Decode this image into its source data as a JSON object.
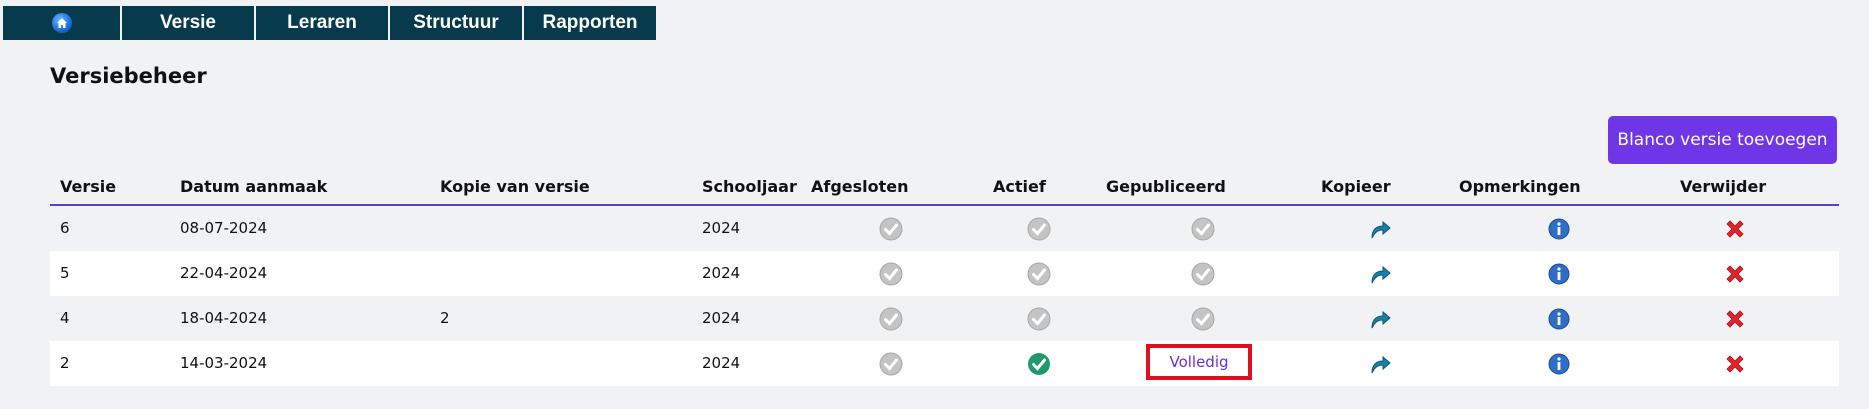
{
  "nav": {
    "home_icon": "home-icon",
    "items": [
      "Versie",
      "Leraren",
      "Structuur",
      "Rapporten"
    ]
  },
  "page": {
    "title": "Versiebeheer",
    "add_button": "Blanco versie toevoegen"
  },
  "colors": {
    "nav_bg": "#083a4e",
    "accent": "#6f36e8",
    "header_rule": "#5b3fd0",
    "highlight_border": "#e0101e"
  },
  "table": {
    "headers": {
      "versie": "Versie",
      "datum": "Datum aanmaak",
      "kopie": "Kopie van versie",
      "schooljaar": "Schooljaar",
      "afgesloten": "Afgesloten",
      "actief": "Actief",
      "gepubliceerd": "Gepubliceerd",
      "kopieer": "Kopieer",
      "opmerkingen": "Opmerkingen",
      "verwijder": "Verwijder"
    },
    "rows": [
      {
        "versie": "6",
        "datum": "08-07-2024",
        "kopie": "",
        "schooljaar": "2024",
        "afgesloten": "grey-check-icon",
        "actief": "grey-check-icon",
        "gepubliceerd": "grey-check-icon",
        "kopieer": "share-arrow-icon",
        "opmerkingen": "info-icon",
        "verwijder": "red-x-icon"
      },
      {
        "versie": "5",
        "datum": "22-04-2024",
        "kopie": "",
        "schooljaar": "2024",
        "afgesloten": "grey-check-icon",
        "actief": "grey-check-icon",
        "gepubliceerd": "grey-check-icon",
        "kopieer": "share-arrow-icon",
        "opmerkingen": "info-icon",
        "verwijder": "red-x-icon"
      },
      {
        "versie": "4",
        "datum": "18-04-2024",
        "kopie": "2",
        "schooljaar": "2024",
        "afgesloten": "grey-check-icon",
        "actief": "grey-check-icon",
        "gepubliceerd": "grey-check-icon",
        "kopieer": "share-arrow-icon",
        "opmerkingen": "info-icon",
        "verwijder": "red-x-icon"
      },
      {
        "versie": "2",
        "datum": "14-03-2024",
        "kopie": "",
        "schooljaar": "2024",
        "afgesloten": "grey-check-icon",
        "actief": "green-check-icon",
        "gepubliceerd_label": "Volledig",
        "kopieer": "share-arrow-icon",
        "opmerkingen": "info-icon",
        "verwijder": "red-x-icon"
      }
    ]
  }
}
